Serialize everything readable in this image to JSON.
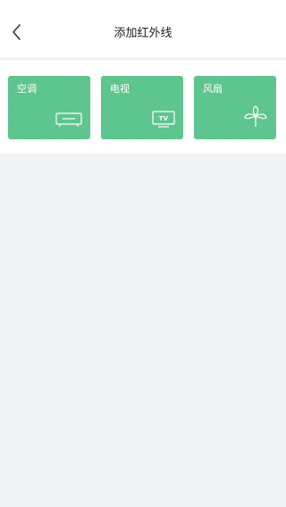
{
  "header": {
    "title": "添加红外线",
    "back_icon": "chevron-left-icon"
  },
  "devices": [
    {
      "label": "空调",
      "icon": "air-conditioner-icon"
    },
    {
      "label": "电视",
      "icon": "tv-icon",
      "icon_text": "TV"
    },
    {
      "label": "风扇",
      "icon": "fan-icon"
    }
  ],
  "colors": {
    "card": "#5cc48d",
    "background": "#f1f2f6",
    "header": "#ffffff"
  }
}
